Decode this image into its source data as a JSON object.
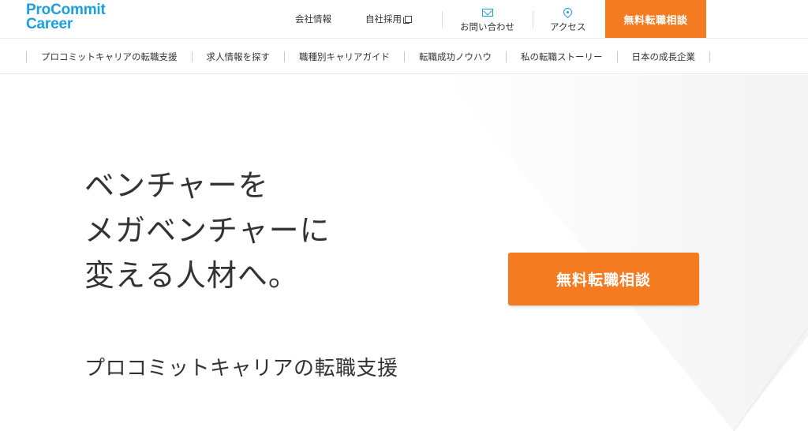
{
  "brand": {
    "line1": "ProCommit",
    "line2": "Career",
    "color": "#1aa0e0"
  },
  "top_links": {
    "company": "会社情報",
    "recruit": "自社採用",
    "contact": "お問い合わせ",
    "access": "アクセス"
  },
  "header_cta": "無料転職相談",
  "nav": [
    "プロコミットキャリアの転職支援",
    "求人情報を探す",
    "職種別キャリアガイド",
    "転職成功ノウハウ",
    "私の転職ストーリー",
    "日本の成長企業"
  ],
  "hero": {
    "headline": [
      "ベンチャーを",
      "メガベンチャーに",
      "変える人材へ。"
    ],
    "subhead": "プロコミットキャリアの転職支援",
    "cta": "無料転職相談"
  },
  "colors": {
    "accent": "#f47b20",
    "brand": "#1aa0e0",
    "text": "#333333"
  },
  "icons": {
    "contact": "mail-icon",
    "access": "map-pin-icon",
    "recruit": "external-link-icon"
  }
}
